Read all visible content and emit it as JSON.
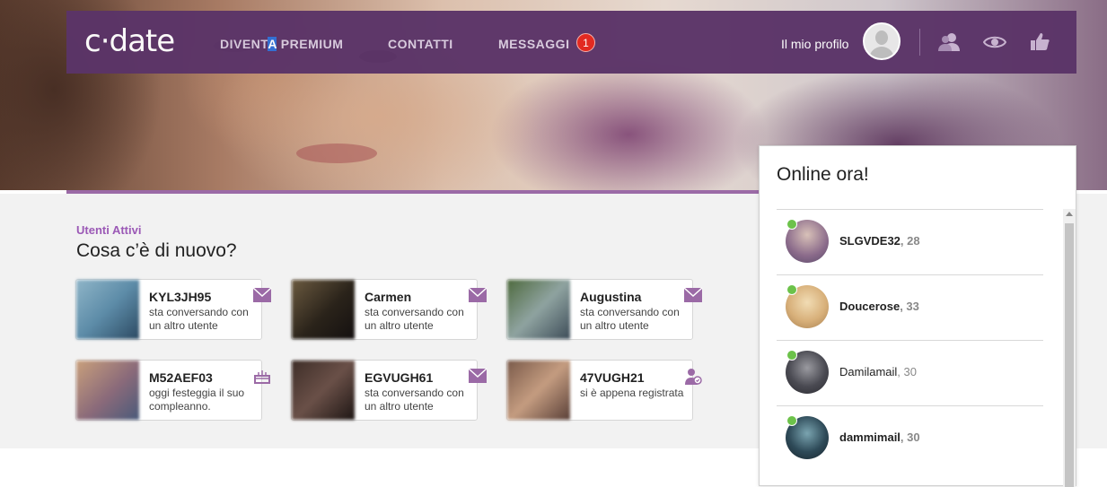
{
  "brand": {
    "logo_text": "c·date"
  },
  "nav": {
    "links": [
      {
        "label_pre": "DIVENT",
        "label_hl": "A",
        "label_post": " PREMIUM"
      },
      {
        "label": "CONTATTI"
      },
      {
        "label": "MESSAGGI",
        "badge": "1"
      }
    ],
    "profile_label": "Il mio profilo",
    "icons": [
      "friends-icon",
      "visitors-eye-icon",
      "likes-thumb-icon"
    ]
  },
  "section": {
    "label": "Utenti Attivi",
    "title": "Cosa c’è di nuovo?"
  },
  "cards": [
    {
      "name": "KYL3JH95",
      "desc": "sta conversando con un altro utente",
      "icon": "envelope-icon"
    },
    {
      "name": "Carmen",
      "desc": "sta conversando con un altro utente",
      "icon": "envelope-icon"
    },
    {
      "name": "Augustina",
      "desc": "sta conversando con un altro utente",
      "icon": "envelope-icon"
    },
    {
      "name": "M52AEF03",
      "desc": "oggi festeggia il suo compleanno.",
      "icon": "birthday-cake-icon"
    },
    {
      "name": "EGVUGH61",
      "desc": "sta conversando con un altro utente",
      "icon": "envelope-icon"
    },
    {
      "name": "47VUGH21",
      "desc": "si è appena registrata",
      "icon": "new-user-icon"
    }
  ],
  "online": {
    "title": "Online ora!",
    "users": [
      {
        "name": "SLGVDE32",
        "age": ", 28",
        "bold": true
      },
      {
        "name": "Doucerose",
        "age": ", 33",
        "bold": true
      },
      {
        "name": "Damilamail",
        "age": ", 30",
        "bold": false
      },
      {
        "name": "dammimail",
        "age": ", 30",
        "bold": true
      }
    ]
  },
  "colors": {
    "nav_bg": "#5b3468",
    "accent": "#9b59b6",
    "badge": "#e2251c",
    "online_dot": "#6cc24a"
  }
}
